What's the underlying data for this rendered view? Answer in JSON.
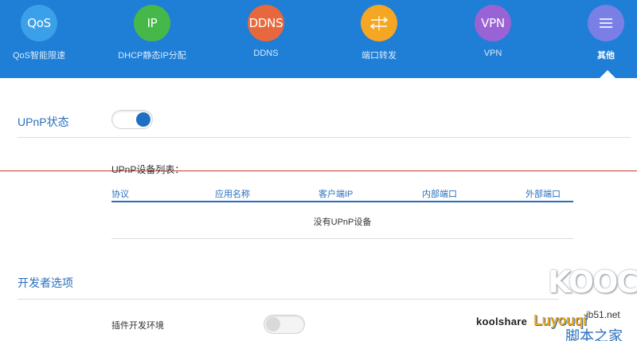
{
  "nav": {
    "items": [
      {
        "icon_text": "QoS",
        "label": "QoS智能限速",
        "color": "#3aa0ea",
        "name": "qos"
      },
      {
        "icon_text": "IP",
        "label": "DHCP静态IP分配",
        "color": "#46b84a",
        "name": "dhcp"
      },
      {
        "icon_text": "DDNS",
        "label": "DDNS",
        "color": "#e8683e",
        "name": "ddns"
      },
      {
        "icon_text": "",
        "label": "端口转发",
        "color": "#f5a623",
        "name": "port-forward",
        "icon": "port-forward-icon"
      },
      {
        "icon_text": "VPN",
        "label": "VPN",
        "color": "#9a63d5",
        "name": "vpn"
      },
      {
        "icon_text": "",
        "label": "其他",
        "color": "#7a7fe6",
        "name": "other",
        "icon": "menu-icon",
        "active": true
      }
    ],
    "bg_color": "#1f7ed6"
  },
  "upnp": {
    "title": "UPnP状态",
    "enabled": true,
    "list_title": "UPnP设备列表：",
    "columns": [
      "协议",
      "应用名称",
      "客户端IP",
      "内部端口",
      "外部端口"
    ],
    "empty_text": "没有UPnP设备"
  },
  "developer": {
    "title": "开发者选项",
    "plugin_env_label": "插件开发环境",
    "plugin_env_enabled": false
  },
  "watermarks": {
    "kooc": "KOOC",
    "jb51": "jb51.net",
    "koolshare": "koolshare",
    "luo": "Luyouqi",
    "home": "脚本之家"
  },
  "colors": {
    "accent": "#2a6fbd",
    "toggle_on": "#1f6fc3"
  }
}
